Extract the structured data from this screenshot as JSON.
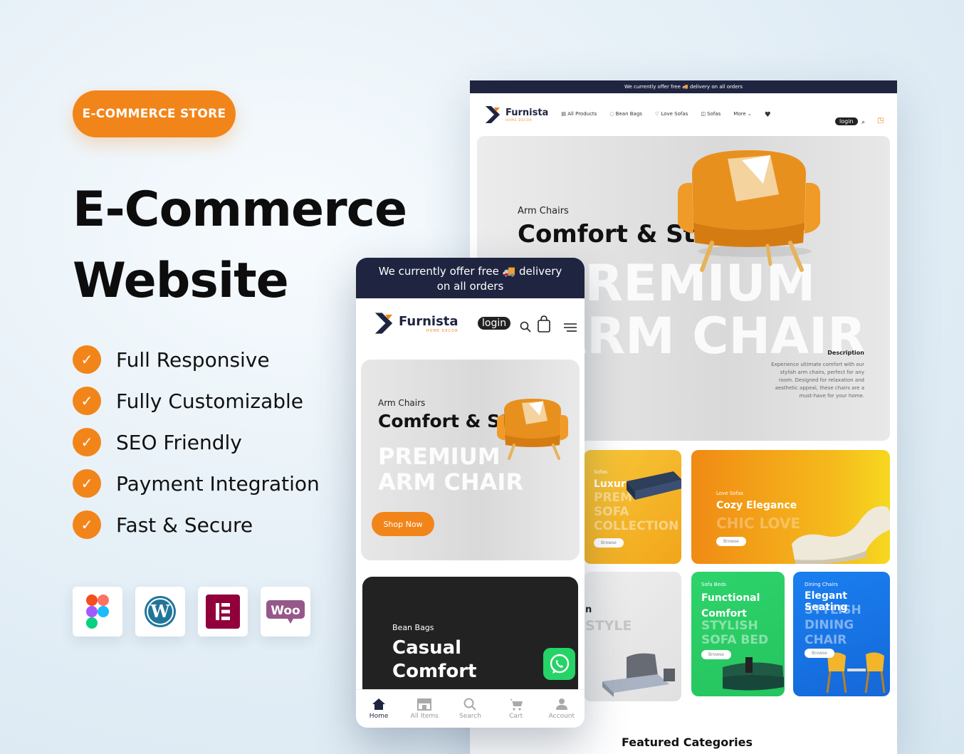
{
  "left": {
    "pill": "E-COMMERCE STORE",
    "headline_line1": "E-Commerce",
    "headline_line2": "Website",
    "features": [
      "Full Responsive",
      "Fully Customizable",
      "SEO Friendly",
      "Payment Integration",
      "Fast & Secure"
    ],
    "tools": [
      "figma-icon",
      "wordpress-icon",
      "elementor-icon",
      "woocommerce-icon"
    ]
  },
  "desktop": {
    "topbar": "We currently offer free 🚚 delivery on all orders",
    "logo": "Furnista",
    "logo_sub": "HOME DECOR",
    "menu": [
      "All Products",
      "Bean Bags",
      "Love Sofas",
      "Sofas",
      "More"
    ],
    "login": "login",
    "hero": {
      "category": "Arm Chairs",
      "title": "Comfort & St",
      "big1": "PREMIUM",
      "big2": "ARM CHAIR",
      "desc_heading": "Description",
      "desc": "Experience ultimate comfort with our stylish arm chairs, perfect for any room. Designed for relaxation and aesthetic appeal, these chairs are a must-have for your home."
    },
    "cards": {
      "sofas": {
        "cat": "Sofas",
        "title": "Luxury",
        "ghost1": "PREM",
        "ghost2": "SOFA",
        "ghost3": "COLLECTION",
        "btn": "Browse"
      },
      "love": {
        "cat": "Love Sofas",
        "title": "Cozy Elegance",
        "ghost": "CHIC LOVE",
        "btn": "Browse"
      },
      "bed": {
        "title": "n",
        "ghost": "STYLE"
      },
      "sofabeds": {
        "cat": "Sofa Beds",
        "title1": "Functional",
        "title2": "Comfort",
        "ghost1": "STYLISH",
        "ghost2": "SOFA BED",
        "btn": "Browse"
      },
      "dining": {
        "cat": "Dining Chairs",
        "title": "Elegant Seating",
        "ghost1": "STYLISH",
        "ghost2": "DINING",
        "ghost3": "CHAIR",
        "btn": "Browse"
      }
    },
    "featured": "Featured Categories"
  },
  "mobile": {
    "topbar": "We currently offer free 🚚 delivery on all orders",
    "logo": "Furnista",
    "logo_sub": "HOME DECOR",
    "login": "login",
    "hero": {
      "category": "Arm Chairs",
      "title": "Comfort & St",
      "big1": "PREMIUM",
      "big2": "ARM CHAIR",
      "button": "Shop Now"
    },
    "second": {
      "category": "Bean Bags",
      "title1": "Casual",
      "title2": "Comfort"
    },
    "tabs": [
      {
        "label": "Home",
        "icon": "home-icon"
      },
      {
        "label": "All Items",
        "icon": "store-icon"
      },
      {
        "label": "Search",
        "icon": "search-icon"
      },
      {
        "label": "Cart",
        "icon": "cart-icon"
      },
      {
        "label": "Account",
        "icon": "user-icon"
      }
    ]
  },
  "colors": {
    "accent": "#f2851a",
    "navy": "#1f2540",
    "green": "#2ed36b",
    "blue": "#1a7ff0",
    "yellow": "#f5b91c"
  }
}
